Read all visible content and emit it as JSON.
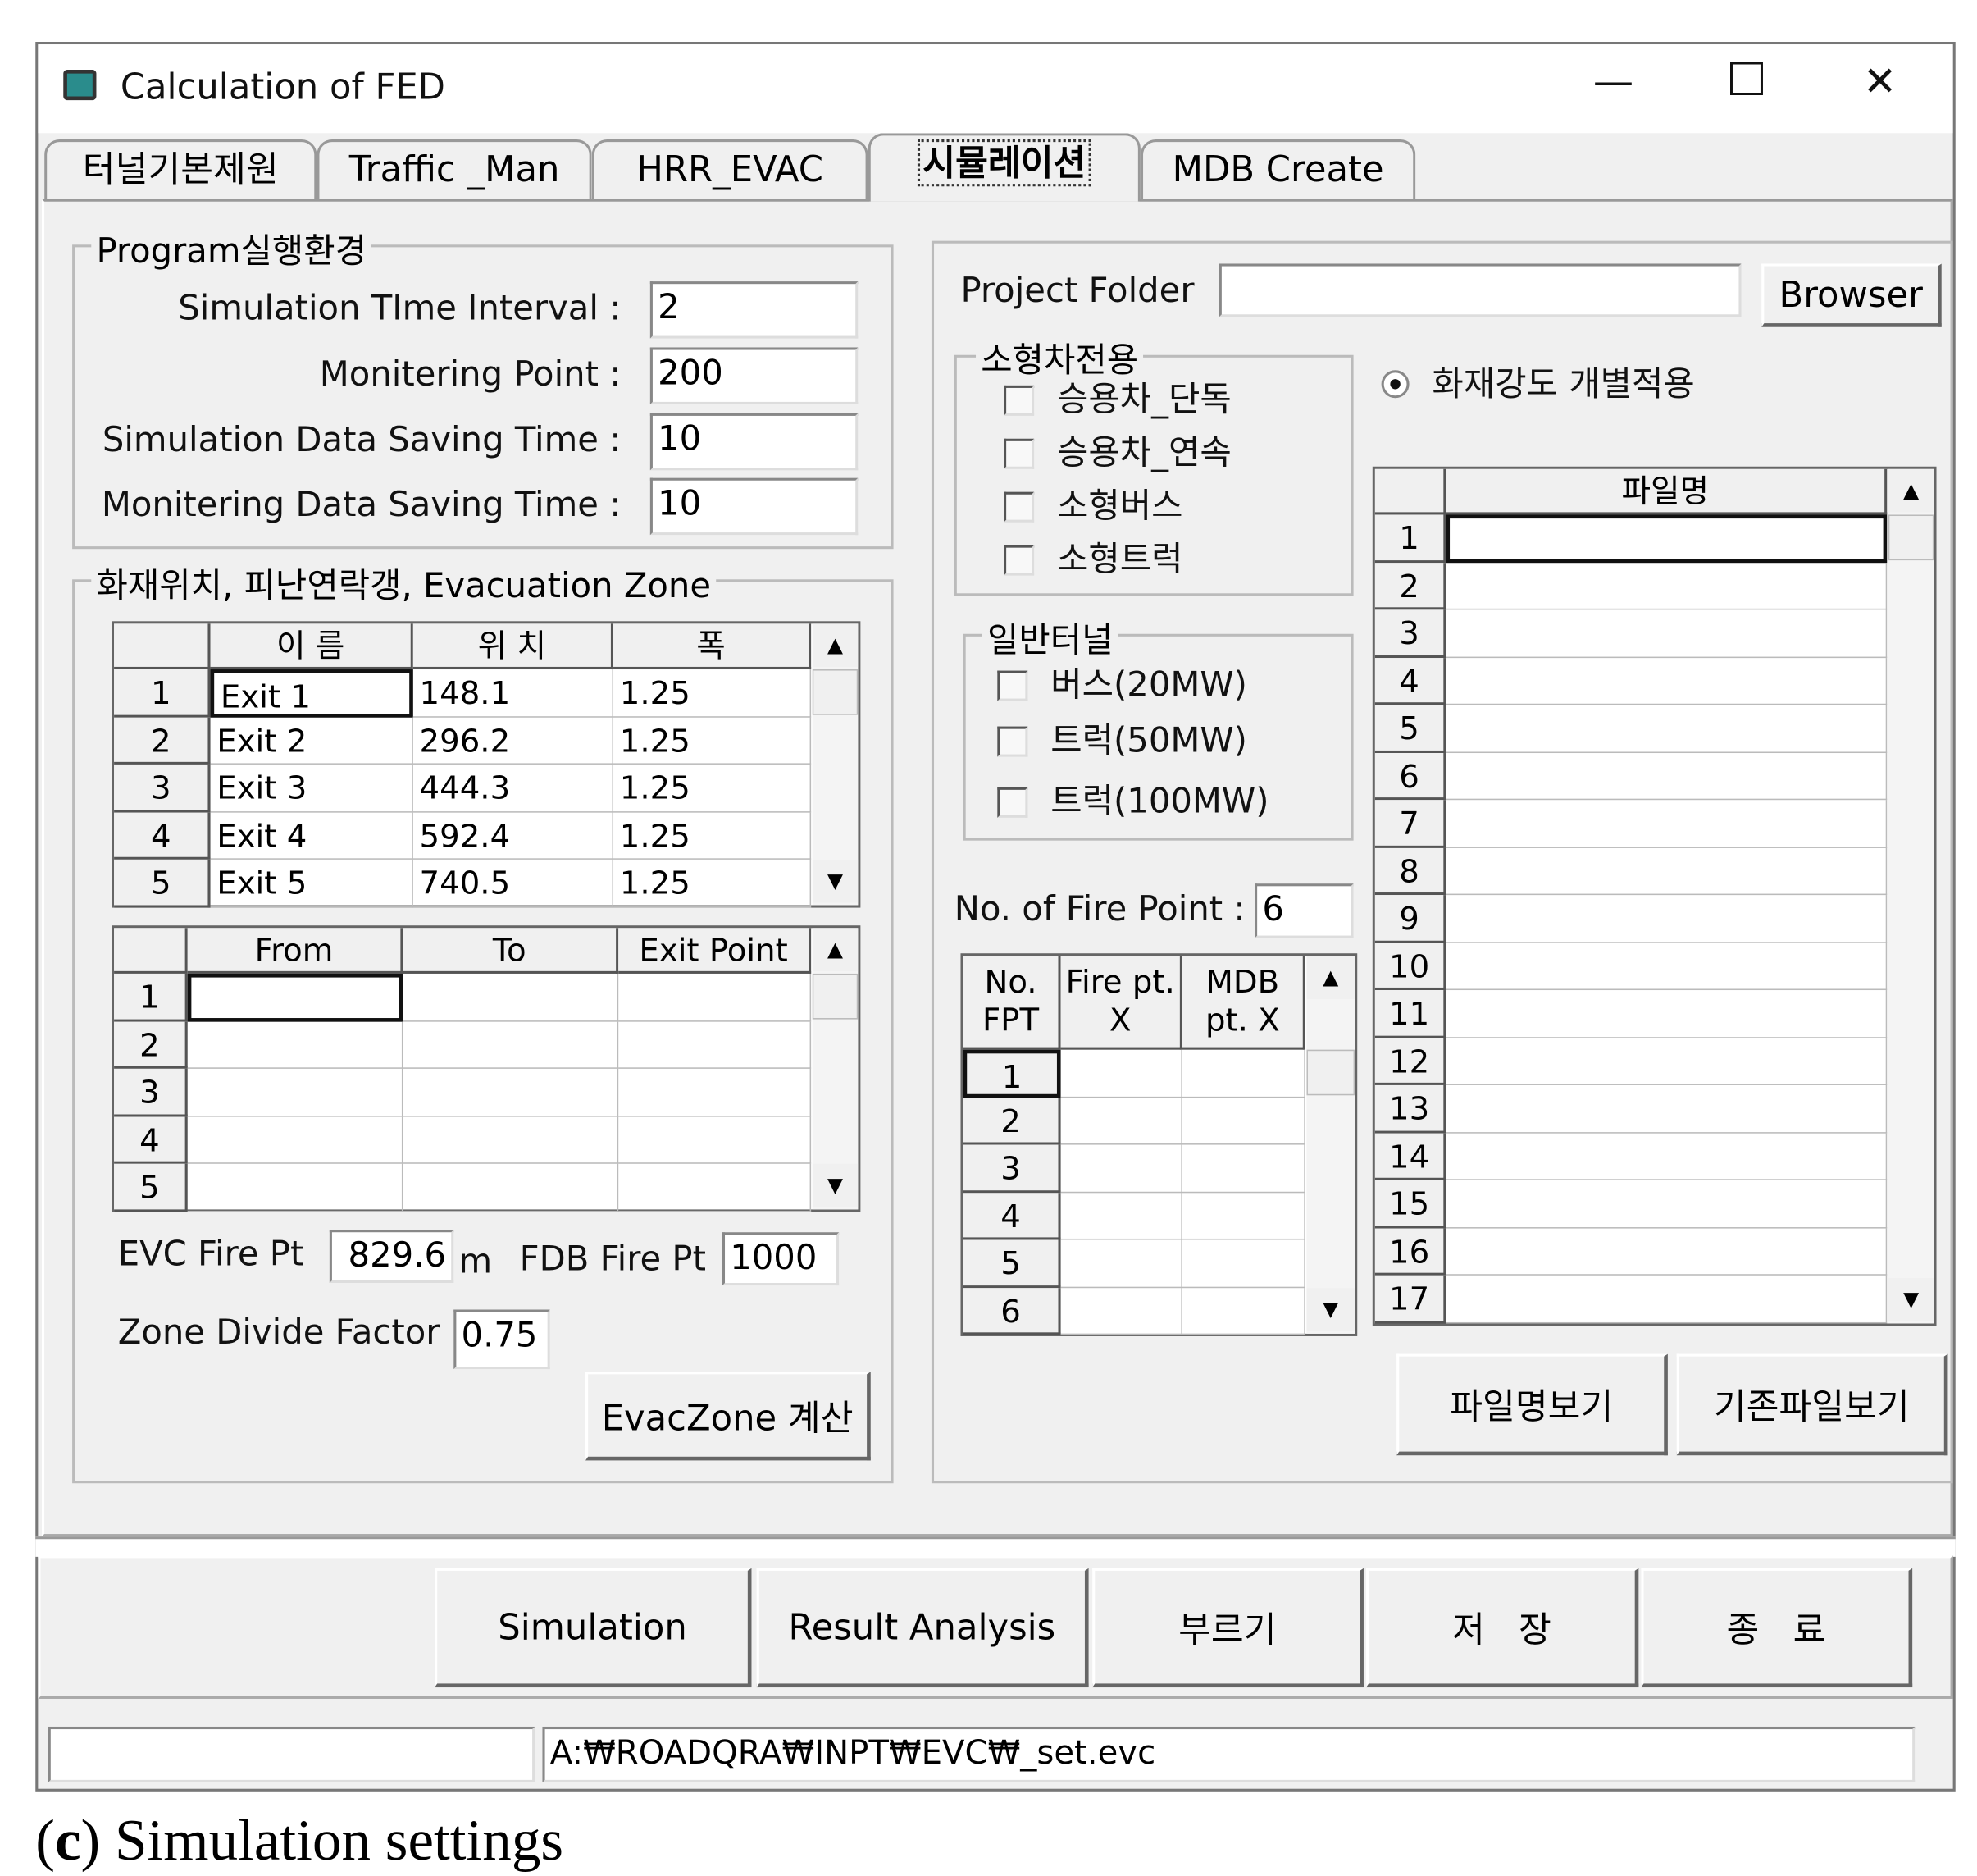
{
  "window": {
    "title": "Calculation of FED",
    "minimize": "—",
    "maximize": "☐",
    "close": "✕"
  },
  "tabs": [
    {
      "label": "터널기본제원"
    },
    {
      "label": "Traffic _Man"
    },
    {
      "label": "HRR_EVAC"
    },
    {
      "label": "시뮬레이션",
      "selected": true
    },
    {
      "label": "MDB Create"
    }
  ],
  "program_env": {
    "title": "Program실행환경",
    "fields": [
      {
        "label": "Simulation TIme Interval :",
        "value": "2"
      },
      {
        "label": "Monitering Point :",
        "value": "200"
      },
      {
        "label": "Simulation Data Saving Time :",
        "value": "10"
      },
      {
        "label": "Monitering Data Saving Time :",
        "value": "10"
      }
    ]
  },
  "fire_location": {
    "title": "화재위치, 피난연락갱, Evacuation Zone",
    "exit_grid": {
      "headers": [
        "이  름",
        "위  치",
        "폭"
      ],
      "rows": [
        {
          "n": "1",
          "name": "Exit 1",
          "pos": "148.1",
          "width": "1.25"
        },
        {
          "n": "2",
          "name": "Exit 2",
          "pos": "296.2",
          "width": "1.25"
        },
        {
          "n": "3",
          "name": "Exit 3",
          "pos": "444.3",
          "width": "1.25"
        },
        {
          "n": "4",
          "name": "Exit 4",
          "pos": "592.4",
          "width": "1.25"
        },
        {
          "n": "5",
          "name": "Exit 5",
          "pos": "740.5",
          "width": "1.25"
        }
      ]
    },
    "zone_grid": {
      "headers": [
        "From",
        "To",
        "Exit Point"
      ],
      "rows": [
        "1",
        "2",
        "3",
        "4",
        "5"
      ]
    },
    "evc_fire_pt_label": "EVC Fire Pt",
    "evc_fire_pt_value": "829.6",
    "evc_unit": "m",
    "fdb_fire_pt_label": "FDB Fire Pt",
    "fdb_fire_pt_value": "1000",
    "zone_divide_label": "Zone Divide Factor",
    "zone_divide_value": "0.75",
    "evaczone_button": "EvacZone 계산"
  },
  "right": {
    "project_folder_label": "Project Folder",
    "project_folder_value": "",
    "browser_button": "Browser",
    "small_vehicle": {
      "title": "소형차전용",
      "items": [
        "승용차_단독",
        "승용차_연속",
        "소형버스",
        "소형트럭"
      ]
    },
    "general_tunnel": {
      "title": "일반터널",
      "items": [
        "버스(20MW)",
        "트럭(50MW)",
        "트럭(100MW)"
      ]
    },
    "fire_point_label": "No. of Fire Point :",
    "fire_point_value": "6",
    "fpt_grid": {
      "headers": [
        "No.\nFPT",
        "Fire pt.\nX",
        "MDB\npt. X"
      ],
      "rows": [
        "1",
        "2",
        "3",
        "4",
        "5",
        "6"
      ]
    },
    "radio_label": "화재강도 개별적용",
    "file_grid": {
      "header": "파일명",
      "rows": [
        "1",
        "2",
        "3",
        "4",
        "5",
        "6",
        "7",
        "8",
        "9",
        "10",
        "11",
        "12",
        "13",
        "14",
        "15",
        "16",
        "17"
      ]
    },
    "filename_view_button": "파일명보기",
    "existing_file_button": "기존파일보기"
  },
  "bottom_buttons": [
    "Simulation",
    "Result Analysis",
    "부르기",
    "저   장",
    "종   료"
  ],
  "status": {
    "left": "",
    "path": "A:₩ROADQRA₩INPT₩EVC₩_set.evc"
  },
  "caption": {
    "letter": "c",
    "text": "Simulation settings"
  }
}
